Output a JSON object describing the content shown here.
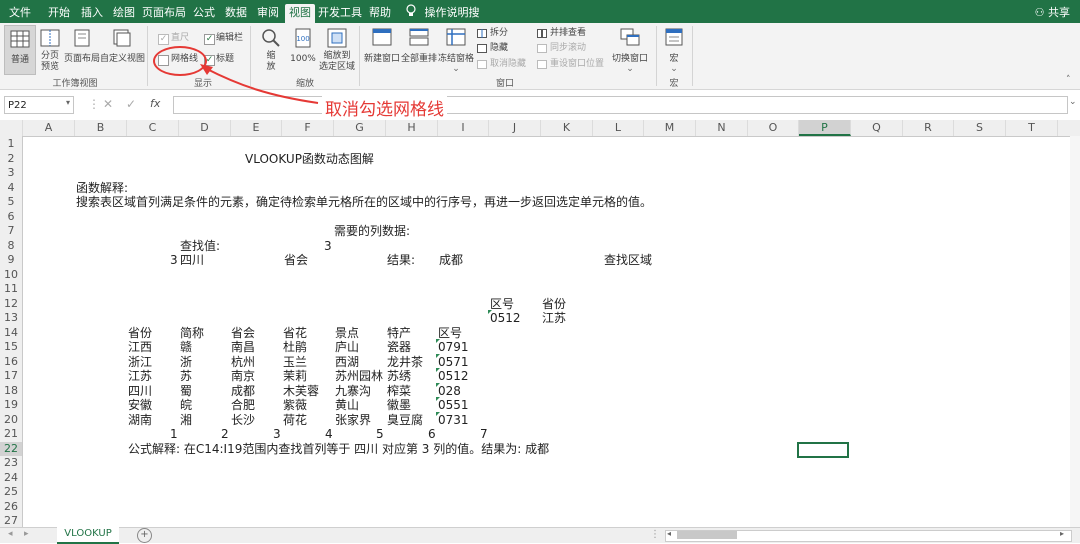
{
  "tabs": [
    "文件",
    "开始",
    "插入",
    "绘图",
    "页面布局",
    "公式",
    "数据",
    "审阅",
    "视图",
    "开发工具",
    "帮助",
    "操作说明搜索"
  ],
  "active_tab": "视图",
  "share": "共享",
  "ribbon": {
    "workbook_views": {
      "normal": "普通",
      "page_break_l1": "分页",
      "page_break_l2": "预览",
      "page_layout": "页面布局",
      "custom_views": "自定义视图",
      "group": "工作簿视图"
    },
    "show": {
      "ruler": "直尺",
      "formula_bar": "编辑栏",
      "gridlines": "网格线",
      "headings": "标题",
      "group": "显示"
    },
    "zoom": {
      "zoom_l1": "缩",
      "zoom_l2": "放",
      "hundred": "100%",
      "to_sel_l1": "缩放到",
      "to_sel_l2": "选定区域",
      "group": "缩放"
    },
    "window": {
      "new_window": "新建窗口",
      "arrange_all": "全部重排",
      "freeze": "冻结窗格",
      "split": "拆分",
      "hide": "隐藏",
      "unhide": "取消隐藏",
      "side_by_side": "并排查看",
      "sync_scroll": "同步滚动",
      "reset_pos": "重设窗口位置",
      "switch": "切换窗口",
      "group": "窗口"
    },
    "macros": {
      "macro": "宏",
      "group": "宏"
    }
  },
  "annotation": "取消勾选网格线",
  "formula_bar": {
    "name_box": "P22",
    "fx": "fx",
    "value": ""
  },
  "columns": [
    "A",
    "B",
    "C",
    "D",
    "E",
    "F",
    "G",
    "H",
    "I",
    "J",
    "K",
    "L",
    "M",
    "N",
    "O",
    "P",
    "Q",
    "R",
    "S",
    "T"
  ],
  "selected_column": "P",
  "rows": [
    "1",
    "2",
    "3",
    "4",
    "5",
    "6",
    "7",
    "8",
    "9",
    "10",
    "11",
    "12",
    "13",
    "14",
    "15",
    "16",
    "17",
    "18",
    "19",
    "20",
    "21",
    "22",
    "23",
    "24",
    "25",
    "26",
    "27"
  ],
  "selected_row": "22",
  "sheet": {
    "title": "VLOOKUP函数动态图解",
    "expl_label": "函数解释:",
    "expl_text": "搜索表区域首列满足条件的元素，确定待检索单元格所在的区域中的行序号，再进一步返回选定单元格的值。",
    "col_needed_label": "需要的列数据:",
    "lookup_label": "查找值:",
    "col_needed_value": "3",
    "lookup_value": "四川",
    "lookup_index": "3",
    "lookup_field": "省会",
    "result_label": "结果:",
    "result_value": "成都",
    "search_area": "查找区域",
    "mini_headers": [
      "区号",
      "省份"
    ],
    "mini_values": [
      "0512",
      "江苏"
    ],
    "table_headers": [
      "省份",
      "简称",
      "省会",
      "省花",
      "景点",
      "特产",
      "区号"
    ],
    "table_rows": [
      [
        "江西",
        "赣",
        "南昌",
        "杜鹃",
        "庐山",
        "瓷器",
        "0791"
      ],
      [
        "浙江",
        "浙",
        "杭州",
        "玉兰",
        "西湖",
        "龙井茶",
        "0571"
      ],
      [
        "江苏",
        "苏",
        "南京",
        "茉莉",
        "苏州园林",
        "苏绣",
        "0512"
      ],
      [
        "四川",
        "蜀",
        "成都",
        "木芙蓉",
        "九寨沟",
        "榨菜",
        "028"
      ],
      [
        "安徽",
        "皖",
        "合肥",
        "紫薇",
        "黄山",
        "徽墨",
        "0551"
      ],
      [
        "湖南",
        "湘",
        "长沙",
        "荷花",
        "张家界",
        "臭豆腐",
        "0731"
      ]
    ],
    "col_numbers": [
      "1",
      "2",
      "3",
      "4",
      "5",
      "6",
      "7"
    ],
    "formula_expl": "公式解释:  在C14:I19范围内查找首列等于 四川 对应第 3 列的值。结果为:  成都"
  },
  "sheet_tab": "VLOOKUP",
  "add_sheet": "+"
}
